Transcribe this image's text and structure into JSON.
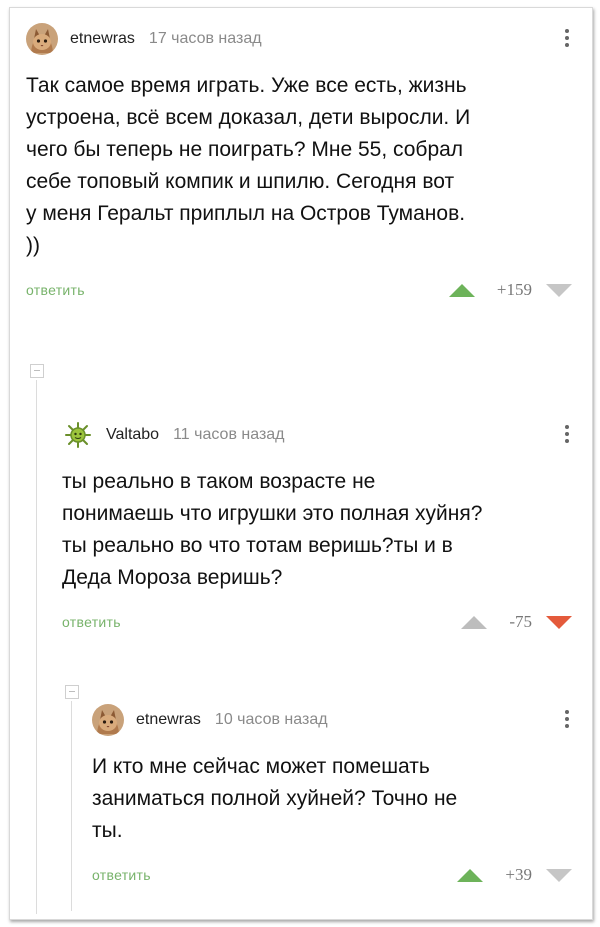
{
  "comments": [
    {
      "username": "etnewras",
      "time": "17 часов назад",
      "text": "Так самое время играть. Уже все есть, жизнь\nустроена, всё всем доказал, дети выросли. И\nчего бы теперь не поиграть? Мне 55, собрал\nсебе топовый компик и шпилю. Сегодня вот\nу меня Геральт приплыл на Остров Туманов.\n))",
      "reply_label": "ответить",
      "score": "+159",
      "avatar_icon": "cat-avatar-icon"
    },
    {
      "username": "Valtabo",
      "time": "11 часов назад",
      "text": "ты реально в таком возрасте не\nпонимаешь что игрушки это полная хуйня?\nты реально во что тотам веришь?ты и в\nДеда Мороза веришь?",
      "reply_label": "ответить",
      "score": "-75",
      "avatar_icon": "virus-avatar-icon"
    },
    {
      "username": "etnewras",
      "time": "10 часов назад",
      "text": "И кто мне сейчас может помешать\nзаниматься полной хуйней? Точно не\nты.",
      "reply_label": "ответить",
      "score": "+39",
      "avatar_icon": "cat-avatar-icon"
    }
  ],
  "colors": {
    "upvote": "#6db35a",
    "downvote_active": "#e45a3b",
    "reply_link": "#78b36b"
  }
}
